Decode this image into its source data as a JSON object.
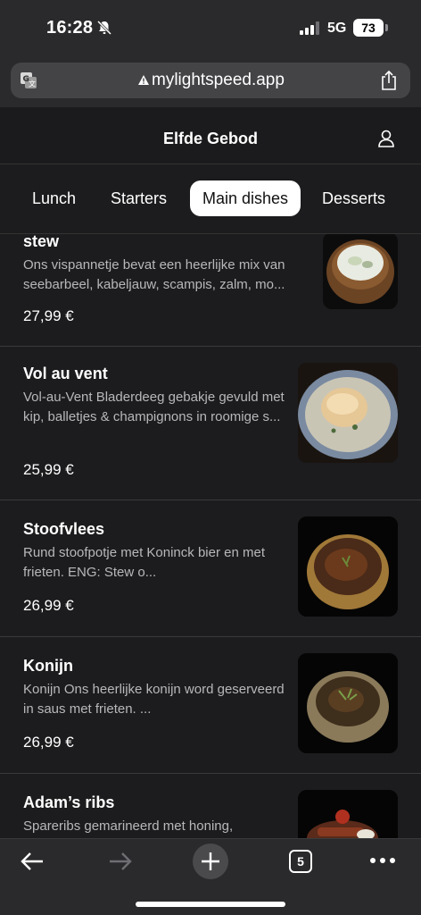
{
  "status": {
    "time": "16:28",
    "network": "5G",
    "battery": "73"
  },
  "browser": {
    "url": "mylightspeed.app",
    "open_tabs": "5"
  },
  "site": {
    "title": "Elfde Gebod"
  },
  "tabs": [
    "Lunch",
    "Starters",
    "Main dishes",
    "Desserts"
  ],
  "dishes": [
    {
      "name": "stew",
      "description": "Ons vispannetje bevat een heerlijke mix van seebarbeel, kabeljauw, scampis, zalm, mo...",
      "price": "27,99 €"
    },
    {
      "name": "Vol au vent",
      "description": "Vol-au-Vent Bladerdeeg gebakje gevuld met\nkip, balletjes & champignons in roomige s...",
      "price": "25,99 €"
    },
    {
      "name": "Stoofvlees",
      "description": "Rund stoofpotje met Koninck bier en met frieten. ENG: Stew o...",
      "price": "26,99 €"
    },
    {
      "name": "Konijn",
      "description": "Konijn Ons heerlijke konijn word geserveerd in saus met frieten. ...",
      "price": "26,99 €"
    },
    {
      "name": "Adam’s ribs",
      "description": "Spareribs gemarineerd met honing,",
      "price": ""
    }
  ]
}
